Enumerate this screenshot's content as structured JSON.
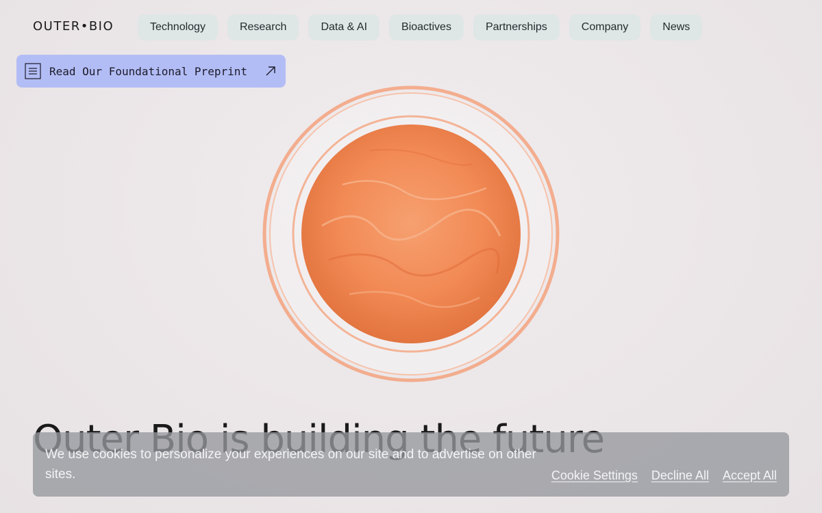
{
  "brand": {
    "logo_text": "OUTER•BIO"
  },
  "nav": {
    "items": [
      "Technology",
      "Research",
      "Data & AI",
      "Bioactives",
      "Partnerships",
      "Company",
      "News"
    ]
  },
  "banner": {
    "label": "Read Our Foundational Preprint",
    "icon": "document-icon",
    "trailing_icon": "arrow-up-right-icon"
  },
  "hero": {
    "headline": "Outer Bio is building the future",
    "image": "orange-culture-petri-dish"
  },
  "cookie": {
    "message": "We use cookies to personalize your experiences on our site and to advertise on other sites.",
    "settings": "Cookie Settings",
    "decline": "Decline All",
    "accept": "Accept All"
  },
  "colors": {
    "nav_bg": "#dfe6e6",
    "banner_bg": "#b3bdf5",
    "culture": "#f28a55",
    "dish_rim": "#f3a684"
  }
}
